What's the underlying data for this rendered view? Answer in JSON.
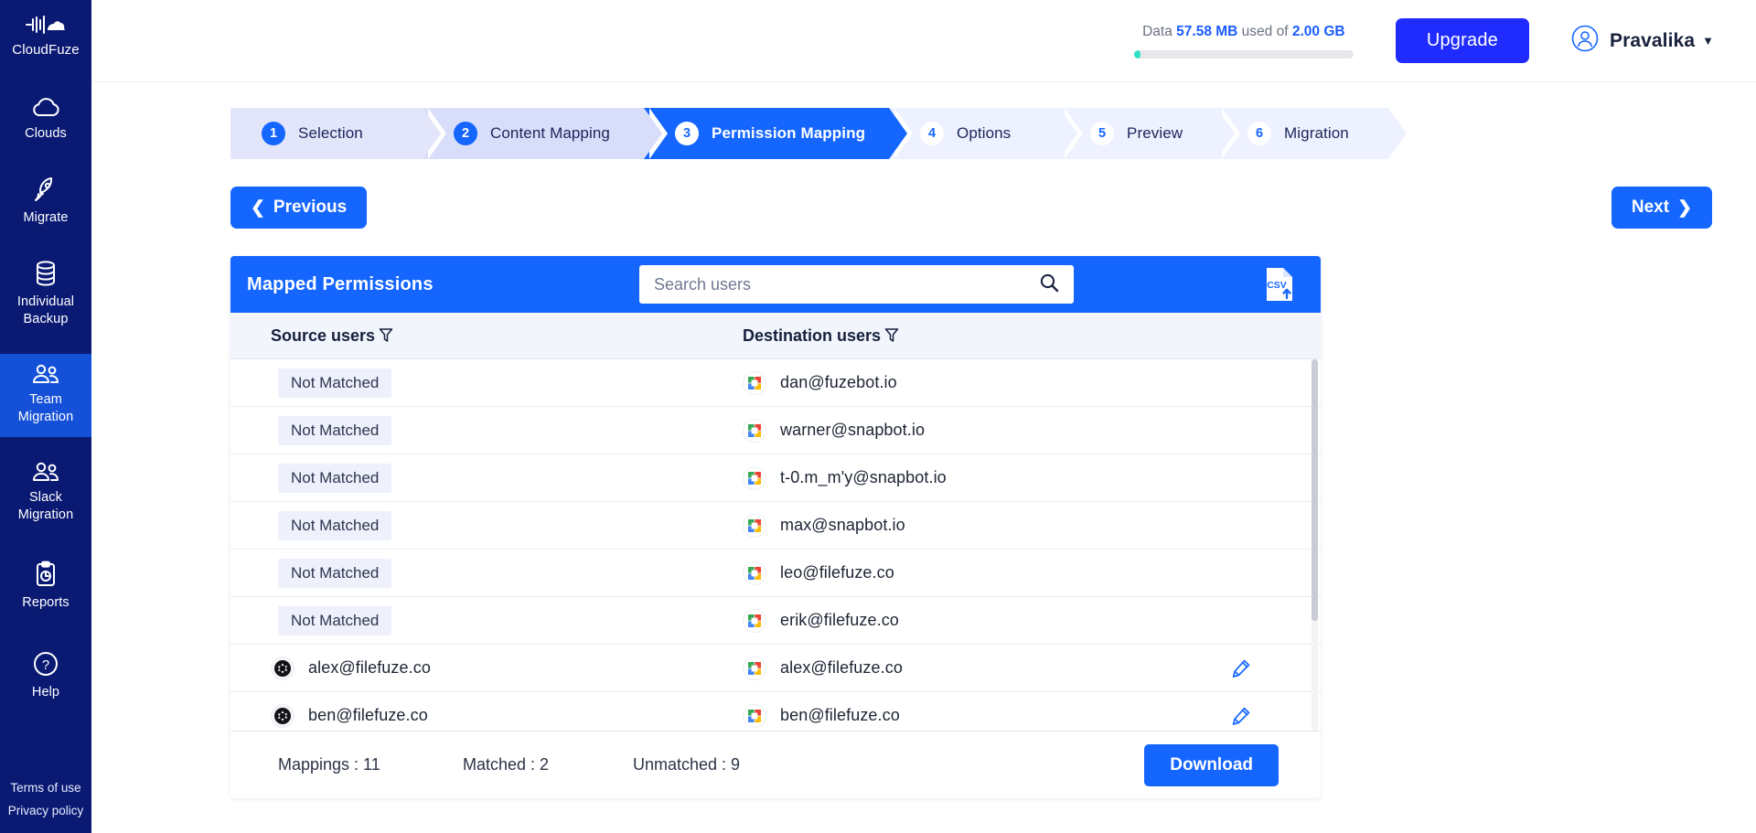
{
  "sidebar": {
    "brand": {
      "label": "CloudFuze",
      "icon": "cloudfuze-logo-icon"
    },
    "items": [
      {
        "label": "Clouds",
        "icon": "cloud-icon",
        "active": false
      },
      {
        "label": "Migrate",
        "icon": "rocket-icon",
        "active": false
      },
      {
        "label": "Individual Backup",
        "icon": "database-icon",
        "active": false
      },
      {
        "label": "Team Migration",
        "icon": "users-icon",
        "active": true
      },
      {
        "label": "Slack Migration",
        "icon": "users-icon",
        "active": false
      },
      {
        "label": "Reports",
        "icon": "clipboard-icon",
        "active": false
      },
      {
        "label": "Help",
        "icon": "question-circle-icon",
        "active": false
      }
    ],
    "footer_links": [
      "Terms of use",
      "Privacy policy"
    ]
  },
  "topbar": {
    "usage_prefix": "Data",
    "usage_used": "57.58 MB",
    "usage_middle": "used of",
    "usage_total": "2.00 GB",
    "usage_percent": 3,
    "upgrade_label": "Upgrade",
    "user_name": "Pravalika",
    "accent_color": "#1f2bff",
    "progress_color": "#2ee0c6"
  },
  "stepper": {
    "steps": [
      {
        "num": "1",
        "label": "Selection",
        "state": "done"
      },
      {
        "num": "2",
        "label": "Content Mapping",
        "state": "done"
      },
      {
        "num": "3",
        "label": "Permission Mapping",
        "state": "active"
      },
      {
        "num": "4",
        "label": "Options",
        "state": "todo"
      },
      {
        "num": "5",
        "label": "Preview",
        "state": "todo"
      },
      {
        "num": "6",
        "label": "Migration",
        "state": "todo"
      }
    ]
  },
  "nav": {
    "previous_label": "Previous",
    "next_label": "Next"
  },
  "card": {
    "title": "Mapped Permissions",
    "search_placeholder": "Search users",
    "search_value": "",
    "csv_icon_label": "CSV",
    "columns": {
      "source": "Source users",
      "destination": "Destination users"
    },
    "rows": [
      {
        "source": "ben@filefuze.co",
        "source_matched": true,
        "destination": "ben@filefuze.co",
        "editable": true
      },
      {
        "source": "alex@filefuze.co",
        "source_matched": true,
        "destination": "alex@filefuze.co",
        "editable": true
      },
      {
        "source": "Not Matched",
        "source_matched": false,
        "destination": "erik@filefuze.co",
        "editable": false
      },
      {
        "source": "Not Matched",
        "source_matched": false,
        "destination": "leo@filefuze.co",
        "editable": false
      },
      {
        "source": "Not Matched",
        "source_matched": false,
        "destination": "max@snapbot.io",
        "editable": false
      },
      {
        "source": "Not Matched",
        "source_matched": false,
        "destination": "t-0.m_m'y@snapbot.io",
        "editable": false
      },
      {
        "source": "Not Matched",
        "source_matched": false,
        "destination": "warner@snapbot.io",
        "editable": false
      },
      {
        "source": "Not Matched",
        "source_matched": false,
        "destination": "dan@fuzebot.io",
        "editable": false
      }
    ],
    "footer": {
      "mappings": "Mappings : 11",
      "matched": "Matched : 2",
      "unmatched": "Unmatched : 9",
      "download_label": "Download"
    }
  }
}
